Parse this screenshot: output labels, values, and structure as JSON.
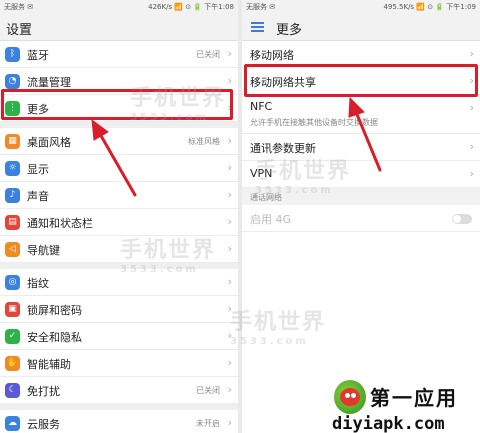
{
  "left": {
    "status": {
      "carrier": "无服务 ✉",
      "right": "426K/s 📶 ⊙ 🔋 下午1:08"
    },
    "title": "设置",
    "groups": [
      [
        {
          "label": "蓝牙",
          "value": "已关闭",
          "icon": "bluetooth-icon",
          "color": "#3b82e0"
        },
        {
          "label": "流量管理",
          "value": "",
          "icon": "data-usage-icon",
          "color": "#3b82e0"
        },
        {
          "label": "更多",
          "value": "",
          "icon": "more-icon",
          "color": "#2bb34a"
        }
      ],
      [
        {
          "label": "桌面风格",
          "value": "标准风格",
          "icon": "home-style-icon",
          "color": "#f08a24"
        },
        {
          "label": "显示",
          "value": "",
          "icon": "display-icon",
          "color": "#3b82e0"
        },
        {
          "label": "声音",
          "value": "",
          "icon": "sound-icon",
          "color": "#3b82e0"
        },
        {
          "label": "通知和状态栏",
          "value": "",
          "icon": "notification-icon",
          "color": "#e0463b"
        },
        {
          "label": "导航键",
          "value": "",
          "icon": "nav-keys-icon",
          "color": "#f08a24"
        }
      ],
      [
        {
          "label": "指纹",
          "value": "",
          "icon": "fingerprint-icon",
          "color": "#3b82e0"
        },
        {
          "label": "锁屏和密码",
          "value": "",
          "icon": "lock-icon",
          "color": "#e0463b"
        },
        {
          "label": "安全和隐私",
          "value": "",
          "icon": "shield-icon",
          "color": "#2bb34a"
        },
        {
          "label": "智能辅助",
          "value": "",
          "icon": "hand-icon",
          "color": "#f08a24"
        },
        {
          "label": "免打扰",
          "value": "已关闭",
          "icon": "moon-icon",
          "color": "#5a5ad6"
        }
      ],
      [
        {
          "label": "云服务",
          "value": "未开启",
          "icon": "cloud-icon",
          "color": "#3b82e0"
        }
      ]
    ]
  },
  "right": {
    "status": {
      "carrier": "无服务 ✉",
      "right": "495.5K/s 📶 ⊙ 🔋 下午1:09"
    },
    "title": "更多",
    "items": [
      {
        "label": "移动网络",
        "sub": ""
      },
      {
        "label": "移动网络共享",
        "sub": ""
      },
      {
        "label": "NFC",
        "sub": "允许手机在接触其他设备时交换数据"
      },
      {
        "label": "通讯参数更新",
        "sub": ""
      },
      {
        "label": "VPN",
        "sub": ""
      }
    ],
    "section_header": "通话网络",
    "disabled_item": {
      "label": "启用 4G"
    }
  },
  "watermark": {
    "text": "手机世界",
    "sub": "3533.com"
  },
  "brand": {
    "cn": "第一应用",
    "url": "diyiapk.com"
  },
  "colors": {
    "accent": "#3a7be0",
    "highlight": "#d81e2a"
  }
}
